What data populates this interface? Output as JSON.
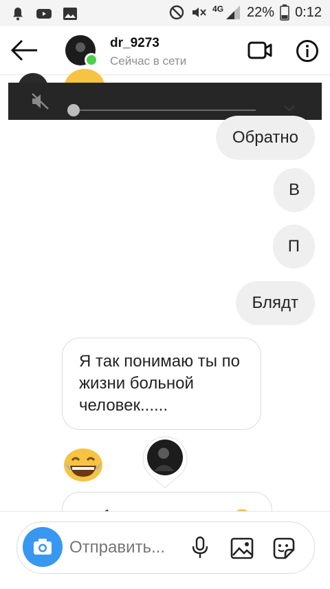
{
  "statusbar": {
    "network": "4G",
    "battery": "22%",
    "time": "0:12"
  },
  "header": {
    "username": "dr_9273",
    "status": "Сейчас в сети"
  },
  "messages": [
    {
      "text": "Обратно",
      "side": "sent"
    },
    {
      "text": "В",
      "side": "sent"
    },
    {
      "text": "П",
      "side": "sent"
    },
    {
      "text": "Блядт",
      "side": "sent"
    },
    {
      "text": "Я так понимаю ты по жизни больной человек......",
      "side": "received"
    }
  ],
  "composer": {
    "placeholder": "Отправить..."
  },
  "volume": {
    "level": 0
  }
}
